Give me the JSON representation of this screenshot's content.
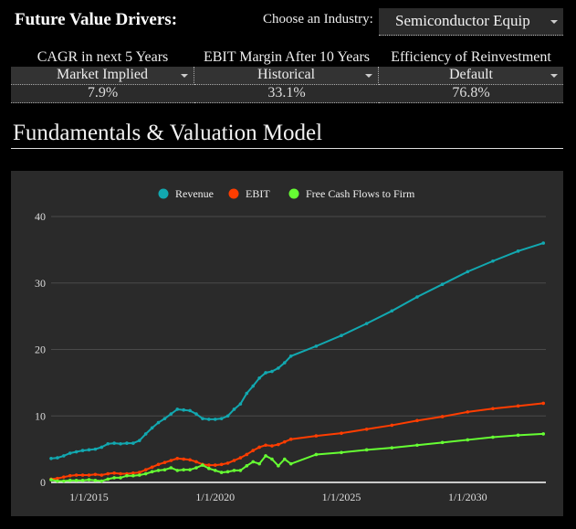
{
  "header": {
    "title": "Future Value Drivers:",
    "industry_label": "Choose an Industry:",
    "industry_value": "Semiconductor Equip"
  },
  "drivers": [
    {
      "label": "CAGR in next 5 Years",
      "selection": "Market Implied",
      "value": "7.9%"
    },
    {
      "label": "EBIT Margin After 10 Years",
      "selection": "Historical",
      "value": "33.1%"
    },
    {
      "label": "Efficiency of Reinvestment",
      "selection": "Default",
      "value": "76.8%"
    }
  ],
  "section_title": "Fundamentals & Valuation Model",
  "chart_data": {
    "type": "line",
    "legend_position": "top-center",
    "ylim": [
      0,
      40
    ],
    "xlim": [
      2013.5,
      2033.1
    ],
    "yticks": [
      0,
      10,
      20,
      30,
      40
    ],
    "xticks": [
      {
        "value": 2015,
        "label": "1/1/2015"
      },
      {
        "value": 2020,
        "label": "1/1/2020"
      },
      {
        "value": 2025,
        "label": "1/1/2025"
      },
      {
        "value": 2030,
        "label": "1/1/2030"
      }
    ],
    "grid": true,
    "x": [
      2013.5,
      2013.75,
      2014,
      2014.25,
      2014.5,
      2014.75,
      2015,
      2015.25,
      2015.5,
      2015.75,
      2016,
      2016.25,
      2016.5,
      2016.75,
      2017,
      2017.25,
      2017.5,
      2017.75,
      2018,
      2018.25,
      2018.5,
      2018.75,
      2019,
      2019.25,
      2019.5,
      2019.75,
      2020,
      2020.25,
      2020.5,
      2020.75,
      2021,
      2021.25,
      2021.5,
      2021.75,
      2022,
      2022.25,
      2022.5,
      2022.75,
      2023,
      2024,
      2025,
      2026,
      2027,
      2028,
      2029,
      2030,
      2031,
      2032,
      2033
    ],
    "series": [
      {
        "name": "Revenue",
        "color": "#12a8b0",
        "values": [
          3.6,
          3.7,
          4.0,
          4.4,
          4.6,
          4.8,
          4.9,
          5.0,
          5.3,
          5.8,
          5.9,
          5.8,
          5.9,
          5.9,
          6.3,
          7.3,
          8.2,
          9.0,
          9.6,
          10.3,
          11.0,
          10.9,
          10.8,
          10.3,
          9.6,
          9.5,
          9.5,
          9.6,
          10.0,
          11.0,
          11.8,
          13.4,
          14.5,
          15.7,
          16.5,
          16.7,
          17.2,
          18.0,
          19.0,
          20.5,
          22.1,
          23.9,
          25.8,
          27.9,
          29.8,
          31.7,
          33.3,
          34.8,
          36.0
        ]
      },
      {
        "name": "EBIT",
        "color": "#ff3d00",
        "values": [
          0.5,
          0.6,
          0.8,
          1.0,
          1.1,
          1.1,
          1.1,
          1.2,
          1.1,
          1.3,
          1.4,
          1.3,
          1.3,
          1.4,
          1.5,
          1.9,
          2.3,
          2.7,
          3.0,
          3.3,
          3.6,
          3.5,
          3.4,
          3.1,
          2.7,
          2.6,
          2.6,
          2.7,
          2.9,
          3.3,
          3.7,
          4.2,
          4.8,
          5.3,
          5.6,
          5.5,
          5.7,
          6.1,
          6.5,
          7.0,
          7.4,
          8.0,
          8.6,
          9.3,
          9.9,
          10.6,
          11.1,
          11.5,
          11.9
        ]
      },
      {
        "name": "Free Cash Flows to Firm",
        "color": "#66ff33",
        "values": [
          0.4,
          0.2,
          0.2,
          0.3,
          0.3,
          0.3,
          0.4,
          0.3,
          0.2,
          0.5,
          0.7,
          0.7,
          1.0,
          1.0,
          1.1,
          1.3,
          1.6,
          1.8,
          1.9,
          2.2,
          1.8,
          1.9,
          1.9,
          2.2,
          2.6,
          2.1,
          1.8,
          1.5,
          1.6,
          1.8,
          1.8,
          2.5,
          3.1,
          2.8,
          4.0,
          3.5,
          2.5,
          3.5,
          2.8,
          4.2,
          4.5,
          4.9,
          5.2,
          5.6,
          6.0,
          6.4,
          6.8,
          7.1,
          7.3
        ]
      }
    ]
  }
}
